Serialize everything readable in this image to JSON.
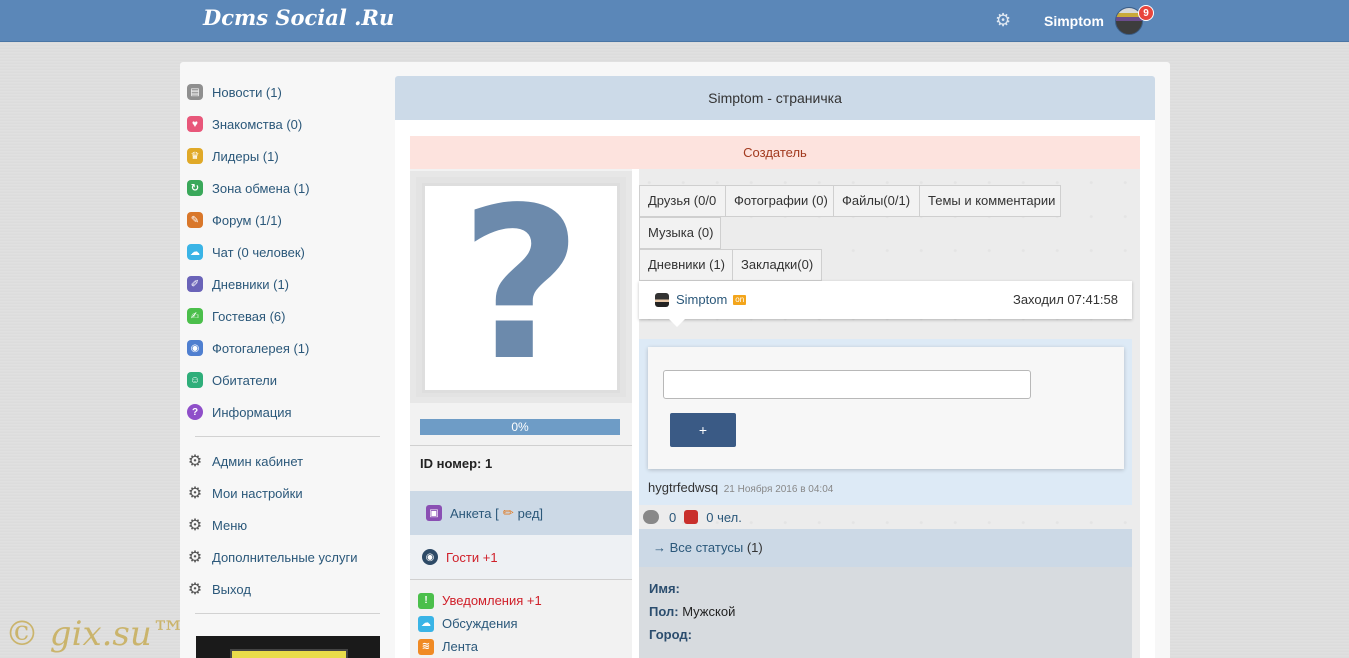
{
  "header": {
    "logo": "Dcms Social .Ru",
    "username": "Simptom",
    "notification_count": "9",
    "settings_icon": "gear-icon"
  },
  "sidebar": {
    "items": [
      {
        "label": "Новости (1)",
        "icon": "news-icon",
        "color": "#8f8f8f"
      },
      {
        "label": "Знакомства (0)",
        "icon": "heart-icon",
        "color": "#e8577a"
      },
      {
        "label": "Лидеры (1)",
        "icon": "trophy-icon",
        "color": "#e0a928"
      },
      {
        "label": "Зона обмена (1)",
        "icon": "exchange-icon",
        "color": "#3aa85a"
      },
      {
        "label": "Форум (1/1)",
        "icon": "forum-icon",
        "color": "#d9772a"
      },
      {
        "label": "Чат (0 человек)",
        "icon": "chat-icon",
        "color": "#3ab4e6"
      },
      {
        "label": "Дневники (1)",
        "icon": "diary-icon",
        "color": "#6a63b8"
      },
      {
        "label": "Гостевая (6)",
        "icon": "guestbook-icon",
        "color": "#4bbf4b"
      },
      {
        "label": "Фотогалерея (1)",
        "icon": "camera-icon",
        "color": "#4f7fd0"
      },
      {
        "label": "Обитатели",
        "icon": "users-icon",
        "color": "#2fae7a"
      },
      {
        "label": "Информация",
        "icon": "info-icon",
        "color": "#8f4fc9"
      }
    ],
    "settings_items": [
      {
        "label": "Админ кабинет"
      },
      {
        "label": "Мои настройки"
      },
      {
        "label": "Меню"
      },
      {
        "label": "Дополнительные услуги"
      },
      {
        "label": "Выход"
      }
    ]
  },
  "main": {
    "title": "Simptom - страничка",
    "creator_label": "Создатель",
    "profile": {
      "progress": "0%",
      "progress_value": 0,
      "id_label": "ID номер: 1",
      "anketa_label": "Анкета [",
      "anketa_edit": "ред]",
      "guests_label": "Гости +1",
      "notifications": [
        {
          "label": "Уведомления +1",
          "icon": "warning-icon",
          "color": "#d0202a"
        },
        {
          "label": "Обсуждения",
          "icon": "cloud-icon",
          "color": "#2b587a"
        },
        {
          "label": "Лента",
          "icon": "rss-icon",
          "color": "#2b587a"
        }
      ]
    },
    "tabs": [
      "Друзья (0/0",
      "Фотографии (0)",
      "Файлы(0/1)",
      "Темы и комментарии",
      "Музыка (0)",
      "Дневники (1)",
      "Закладки(0)"
    ],
    "status_card": {
      "username": "Simptom",
      "online_badge": "on",
      "last_visit": "Заходил 07:41:58"
    },
    "status": {
      "input_value": "",
      "submit_label": "+",
      "text": "hygtrfedwsq",
      "date": "21 Ноября 2016 в 04:04",
      "comments_count": "0",
      "likes_text": "0 чел."
    },
    "all_statuses": "→ Все статусы",
    "all_statuses_count": "(1)",
    "info": {
      "name_label": "Имя:",
      "name_value": "",
      "gender_label": "Пол:",
      "gender_value": "Мужской",
      "city_label": "Город:",
      "city_value": ""
    }
  },
  "watermark": "© gix.su™"
}
